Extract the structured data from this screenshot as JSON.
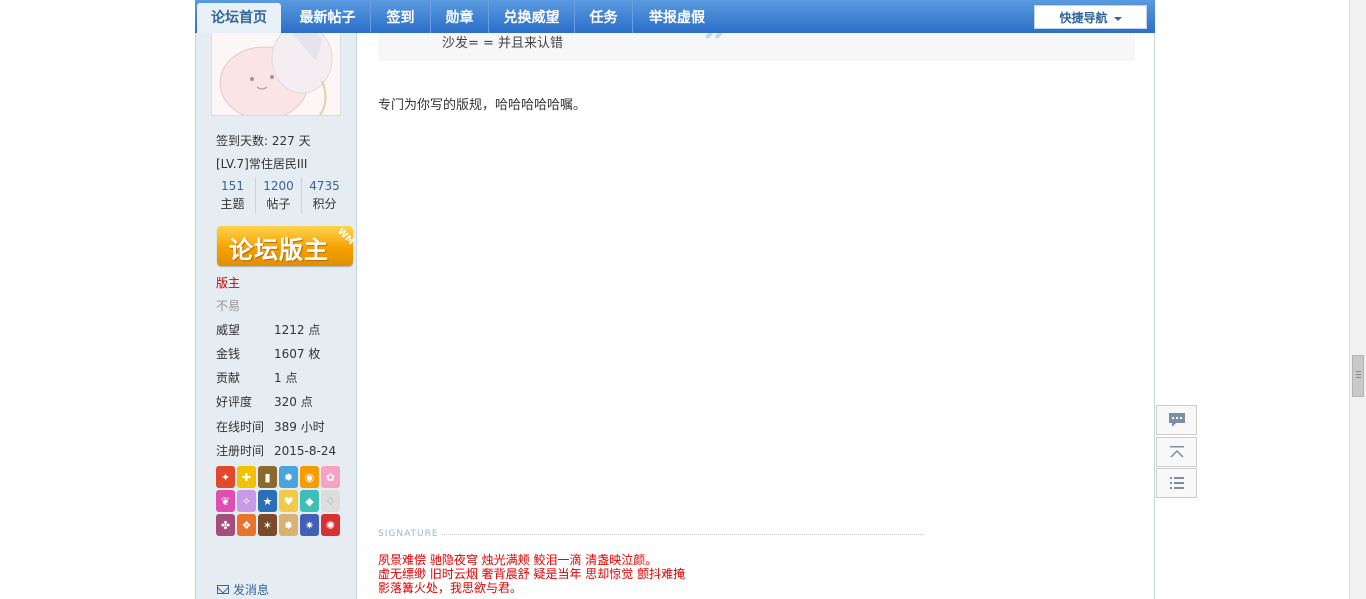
{
  "nav": {
    "items": [
      {
        "label": "论坛首页",
        "active": true
      },
      {
        "label": "最新帖子",
        "active": false
      },
      {
        "label": "签到",
        "active": false
      },
      {
        "label": "勋章",
        "active": false
      },
      {
        "label": "兑换威望",
        "active": false
      },
      {
        "label": "任务",
        "active": false
      },
      {
        "label": "举报虚假",
        "active": false
      }
    ],
    "quick_nav": "快捷导航"
  },
  "sidebar": {
    "checkin": "签到天数: 227 天",
    "level": "[LV.7]常住居民III",
    "stats": [
      {
        "value": "151",
        "label": "主题"
      },
      {
        "value": "1200",
        "label": "帖子"
      },
      {
        "value": "4735",
        "label": "积分"
      }
    ],
    "badge_text": "论坛版主",
    "badge_corner": "WM",
    "group": "版主",
    "custom_title": "不易",
    "fields": [
      {
        "key": "威望",
        "value": "1212 点"
      },
      {
        "key": "金钱",
        "value": "1607 枚"
      },
      {
        "key": "贡献",
        "value": "1 点"
      },
      {
        "key": "好评度",
        "value": "320 点"
      },
      {
        "key": "在线时间",
        "value": "389 小时"
      },
      {
        "key": "注册时间",
        "value": "2015-8-24"
      }
    ],
    "send_message": "发消息"
  },
  "post": {
    "quote_text": "沙发= = 并且来认错",
    "body": "专门为你写的版规，哈哈哈哈哈嘱。",
    "signature_label": "SIGNATURE",
    "signature_lines": [
      "夙景难偿 驰隐夜穹  烛光满颊 鲛泪一滴   清盏映泣颜。",
      "虚无缥缈 旧时云烟  奢背晨舒 疑是当年   思却惊觉  颤抖难掩",
      "影落篝火处，我思欲与君。"
    ]
  },
  "colors": {
    "nav_top": "#5a9ae0",
    "nav_bottom": "#2b6fc8",
    "sidebar_bg": "#e5edf2",
    "link": "#336699",
    "signature": "#e00000",
    "group": "#d40000"
  }
}
